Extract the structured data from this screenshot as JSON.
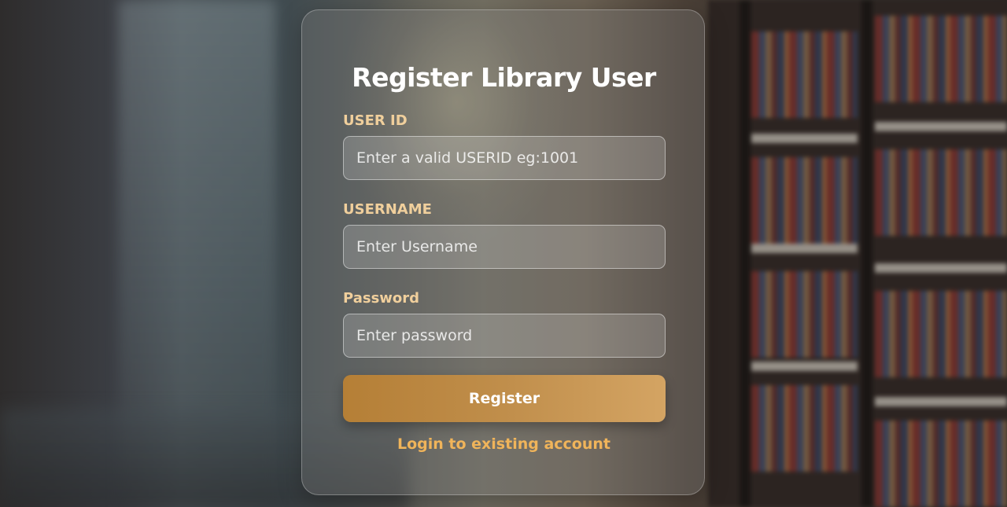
{
  "page": {
    "background": "blurred-library-bookshelves-photo"
  },
  "form": {
    "title": "Register Library User",
    "user_id": {
      "label": "USER ID",
      "placeholder": "Enter a valid USERID eg:1001",
      "value": ""
    },
    "username": {
      "label": "USERNAME",
      "placeholder": "Enter Username",
      "value": ""
    },
    "password": {
      "label": "Password",
      "placeholder": "Enter password",
      "value": ""
    },
    "submit_label": "Register",
    "login_link": "Login to existing account"
  },
  "colors": {
    "label": "#f0cf9c",
    "button_start": "#b57f36",
    "button_end": "#d4a463",
    "link": "#f0b45a"
  }
}
